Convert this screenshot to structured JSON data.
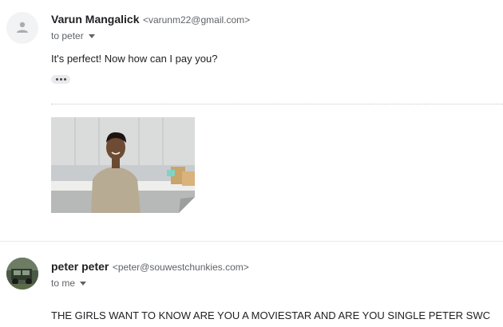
{
  "messages": [
    {
      "sender_name": "Varun Mangalick",
      "sender_email": "<varunm22@gmail.com>",
      "to": "to peter",
      "body": "It's perfect! Now how can I pay you?",
      "has_trimmed_content": true,
      "attachment_icon": "photo-of-person-in-sweater"
    },
    {
      "sender_name": "peter peter",
      "sender_email": "<peter@souwestchunkies.com>",
      "to": "to me",
      "body": "THE GIRLS WANT TO KNOW ARE YOU A MOVIESTAR AND ARE YOU SINGLE PETER SWC"
    }
  ],
  "icons": {
    "default_avatar": "person-icon",
    "expand_to": "chevron-down-icon",
    "show_trimmed": "ellipsis-icon"
  },
  "colors": {
    "name": "#202124",
    "secondary": "#5f6368",
    "divider": "#e8eaed"
  }
}
